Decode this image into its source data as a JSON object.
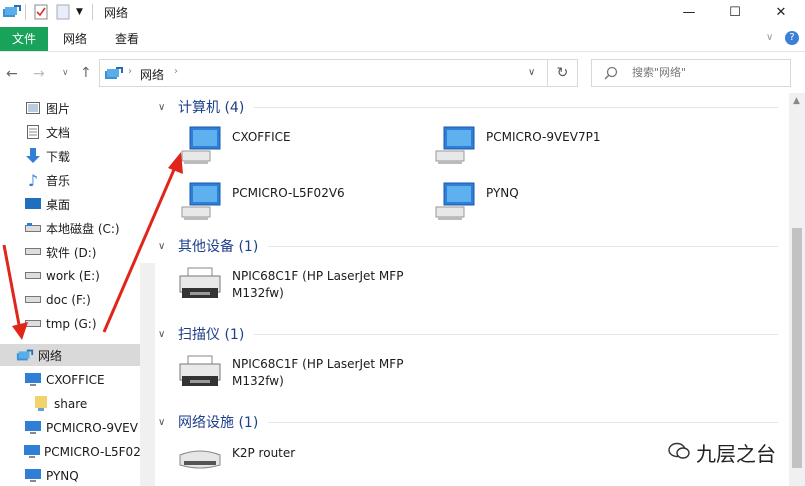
{
  "title": "网络",
  "window_buttons": {
    "minimize": "—",
    "maximize": "☐",
    "close": "✕"
  },
  "ribbon": {
    "tabs": [
      "文件",
      "网络",
      "查看"
    ]
  },
  "address": {
    "path": "网络",
    "refresh": "↻"
  },
  "search": {
    "placeholder": "搜索\"网络\""
  },
  "nav": {
    "items": [
      {
        "label": "图片",
        "icon": "pictures-icon"
      },
      {
        "label": "文档",
        "icon": "documents-icon"
      },
      {
        "label": "下载",
        "icon": "downloads-icon"
      },
      {
        "label": "音乐",
        "icon": "music-icon"
      },
      {
        "label": "桌面",
        "icon": "desktop-icon"
      },
      {
        "label": "本地磁盘 (C:)",
        "icon": "drive-icon"
      },
      {
        "label": "软件 (D:)",
        "icon": "drive-icon"
      },
      {
        "label": "work (E:)",
        "icon": "drive-icon"
      },
      {
        "label": "doc (F:)",
        "icon": "drive-icon"
      },
      {
        "label": "tmp (G:)",
        "icon": "drive-icon"
      },
      {
        "label": "网络",
        "icon": "network-icon",
        "selected": true
      },
      {
        "label": "CXOFFICE",
        "icon": "computer-icon"
      },
      {
        "label": "share",
        "icon": "shared-folder-icon"
      },
      {
        "label": "PCMICRO-9VEV",
        "icon": "computer-icon"
      },
      {
        "label": "PCMICRO-L5F02",
        "icon": "computer-icon"
      },
      {
        "label": "PYNQ",
        "icon": "computer-icon"
      }
    ]
  },
  "groups": [
    {
      "header": "计算机 (4)",
      "items": [
        "CXOFFICE",
        "PCMICRO-9VEV7P1",
        "PCMICRO-L5F02V6",
        "PYNQ"
      ]
    },
    {
      "header": "其他设备 (1)",
      "items": [
        "NPIC68C1F (HP LaserJet MFP M132fw)"
      ]
    },
    {
      "header": "扫描仪 (1)",
      "items": [
        "NPIC68C1F (HP LaserJet MFP M132fw)"
      ]
    },
    {
      "header": "网络设施 (1)",
      "items": [
        "K2P router"
      ]
    }
  ],
  "watermark": "九层之台",
  "colors": {
    "file_tab": "#19a25a",
    "group_header": "#1e3f8a",
    "arrow": "#e0261b"
  }
}
